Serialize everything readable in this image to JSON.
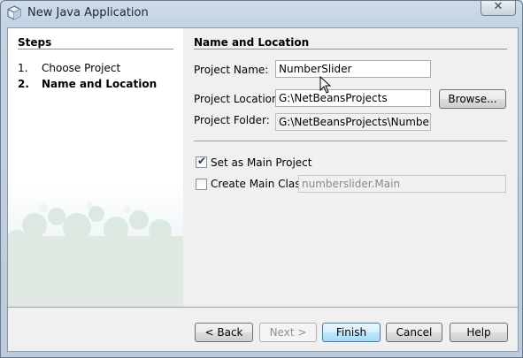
{
  "window": {
    "title": "New Java Application",
    "close_label": "✕"
  },
  "steps": {
    "heading": "Steps",
    "items": [
      {
        "num": "1.",
        "label": "Choose Project"
      },
      {
        "num": "2.",
        "label": "Name and Location"
      }
    ],
    "current_index": 1
  },
  "form": {
    "section_title": "Name and Location",
    "project_name_label": "Project Name:",
    "project_name_value": "NumberSlider",
    "project_location_label": "Project Location:",
    "project_location_value": "G:\\NetBeansProjects",
    "browse_label": "Browse...",
    "project_folder_label": "Project Folder:",
    "project_folder_value": "G:\\NetBeansProjects\\NumberSlider",
    "set_main_label": "Set as Main Project",
    "set_main_checked": true,
    "create_main_label": "Create Main Class",
    "create_main_checked": false,
    "main_class_value": "numberslider.Main"
  },
  "buttons": {
    "back": "< Back",
    "next": "Next >",
    "finish": "Finish",
    "cancel": "Cancel",
    "help": "Help"
  }
}
